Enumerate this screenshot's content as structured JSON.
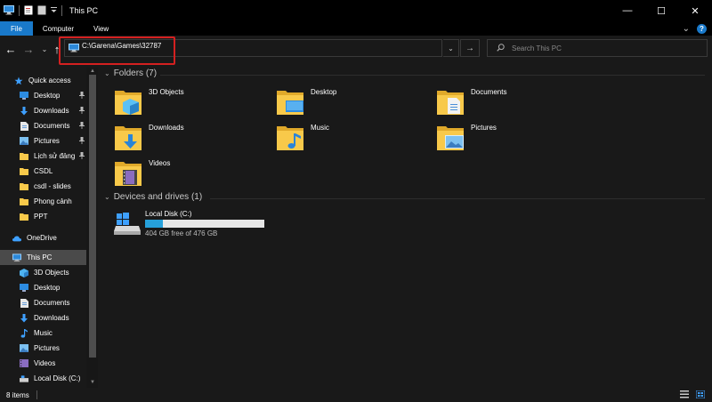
{
  "window": {
    "title": "This PC",
    "minimize_glyph": "—",
    "maximize_glyph": "☐",
    "close_glyph": "✕"
  },
  "ribbon": {
    "tabs": [
      "File",
      "Computer",
      "View"
    ],
    "expand_glyph": "⌄",
    "help_glyph": "?"
  },
  "address": {
    "back_glyph": "←",
    "forward_glyph": "→",
    "recent_glyph": "⌄",
    "up_glyph": "↑",
    "path": "C:\\Garena\\Games\\32787",
    "dropdown_glyph": "⌄",
    "refresh_glyph": "→",
    "search_placeholder": "Search This PC"
  },
  "sidebar": {
    "quick_access": "Quick access",
    "items": [
      {
        "label": "Quick access",
        "icon": "star-icon"
      },
      {
        "label": "Desktop",
        "icon": "desktop-icon",
        "pinned": true
      },
      {
        "label": "Downloads",
        "icon": "downloads-icon",
        "pinned": true
      },
      {
        "label": "Documents",
        "icon": "documents-icon",
        "pinned": true
      },
      {
        "label": "Pictures",
        "icon": "pictures-icon",
        "pinned": true
      },
      {
        "label": "Lịch sử đảng",
        "icon": "folder-icon",
        "pinned": true
      },
      {
        "label": "CSDL",
        "icon": "folder-icon"
      },
      {
        "label": "csdl - slides",
        "icon": "folder-icon"
      },
      {
        "label": "Phong cảnh",
        "icon": "folder-icon"
      },
      {
        "label": "PPT",
        "icon": "folder-icon"
      },
      {
        "label": "OneDrive",
        "icon": "onedrive-icon"
      },
      {
        "label": "This PC",
        "icon": "this-pc-icon",
        "selected": true
      },
      {
        "label": "3D Objects",
        "icon": "3d-objects-icon"
      },
      {
        "label": "Desktop",
        "icon": "desktop-icon"
      },
      {
        "label": "Documents",
        "icon": "documents-icon"
      },
      {
        "label": "Downloads",
        "icon": "downloads-icon"
      },
      {
        "label": "Music",
        "icon": "music-icon"
      },
      {
        "label": "Pictures",
        "icon": "pictures-icon"
      },
      {
        "label": "Videos",
        "icon": "videos-icon"
      },
      {
        "label": "Local Disk (C:)",
        "icon": "drive-icon"
      }
    ]
  },
  "main": {
    "folders_header": "Folders (7)",
    "folders": [
      {
        "label": "3D Objects",
        "icon": "3d-objects-folder-icon"
      },
      {
        "label": "Desktop",
        "icon": "desktop-folder-icon"
      },
      {
        "label": "Documents",
        "icon": "documents-folder-icon"
      },
      {
        "label": "Downloads",
        "icon": "downloads-folder-icon"
      },
      {
        "label": "Music",
        "icon": "music-folder-icon"
      },
      {
        "label": "Pictures",
        "icon": "pictures-folder-icon"
      },
      {
        "label": "Videos",
        "icon": "videos-folder-icon"
      }
    ],
    "devices_header": "Devices and drives (1)",
    "drive": {
      "label": "Local Disk (C:)",
      "free_text": "404 GB free of 476 GB",
      "used_fraction": 0.151,
      "icon": "windows-drive-icon"
    }
  },
  "status": {
    "items_count": "8 items"
  },
  "colors": {
    "accent": "#1979ca",
    "highlight_border": "#d42020",
    "folder_yellow": "#f8c94a",
    "drive_fill": "#26a0da"
  }
}
